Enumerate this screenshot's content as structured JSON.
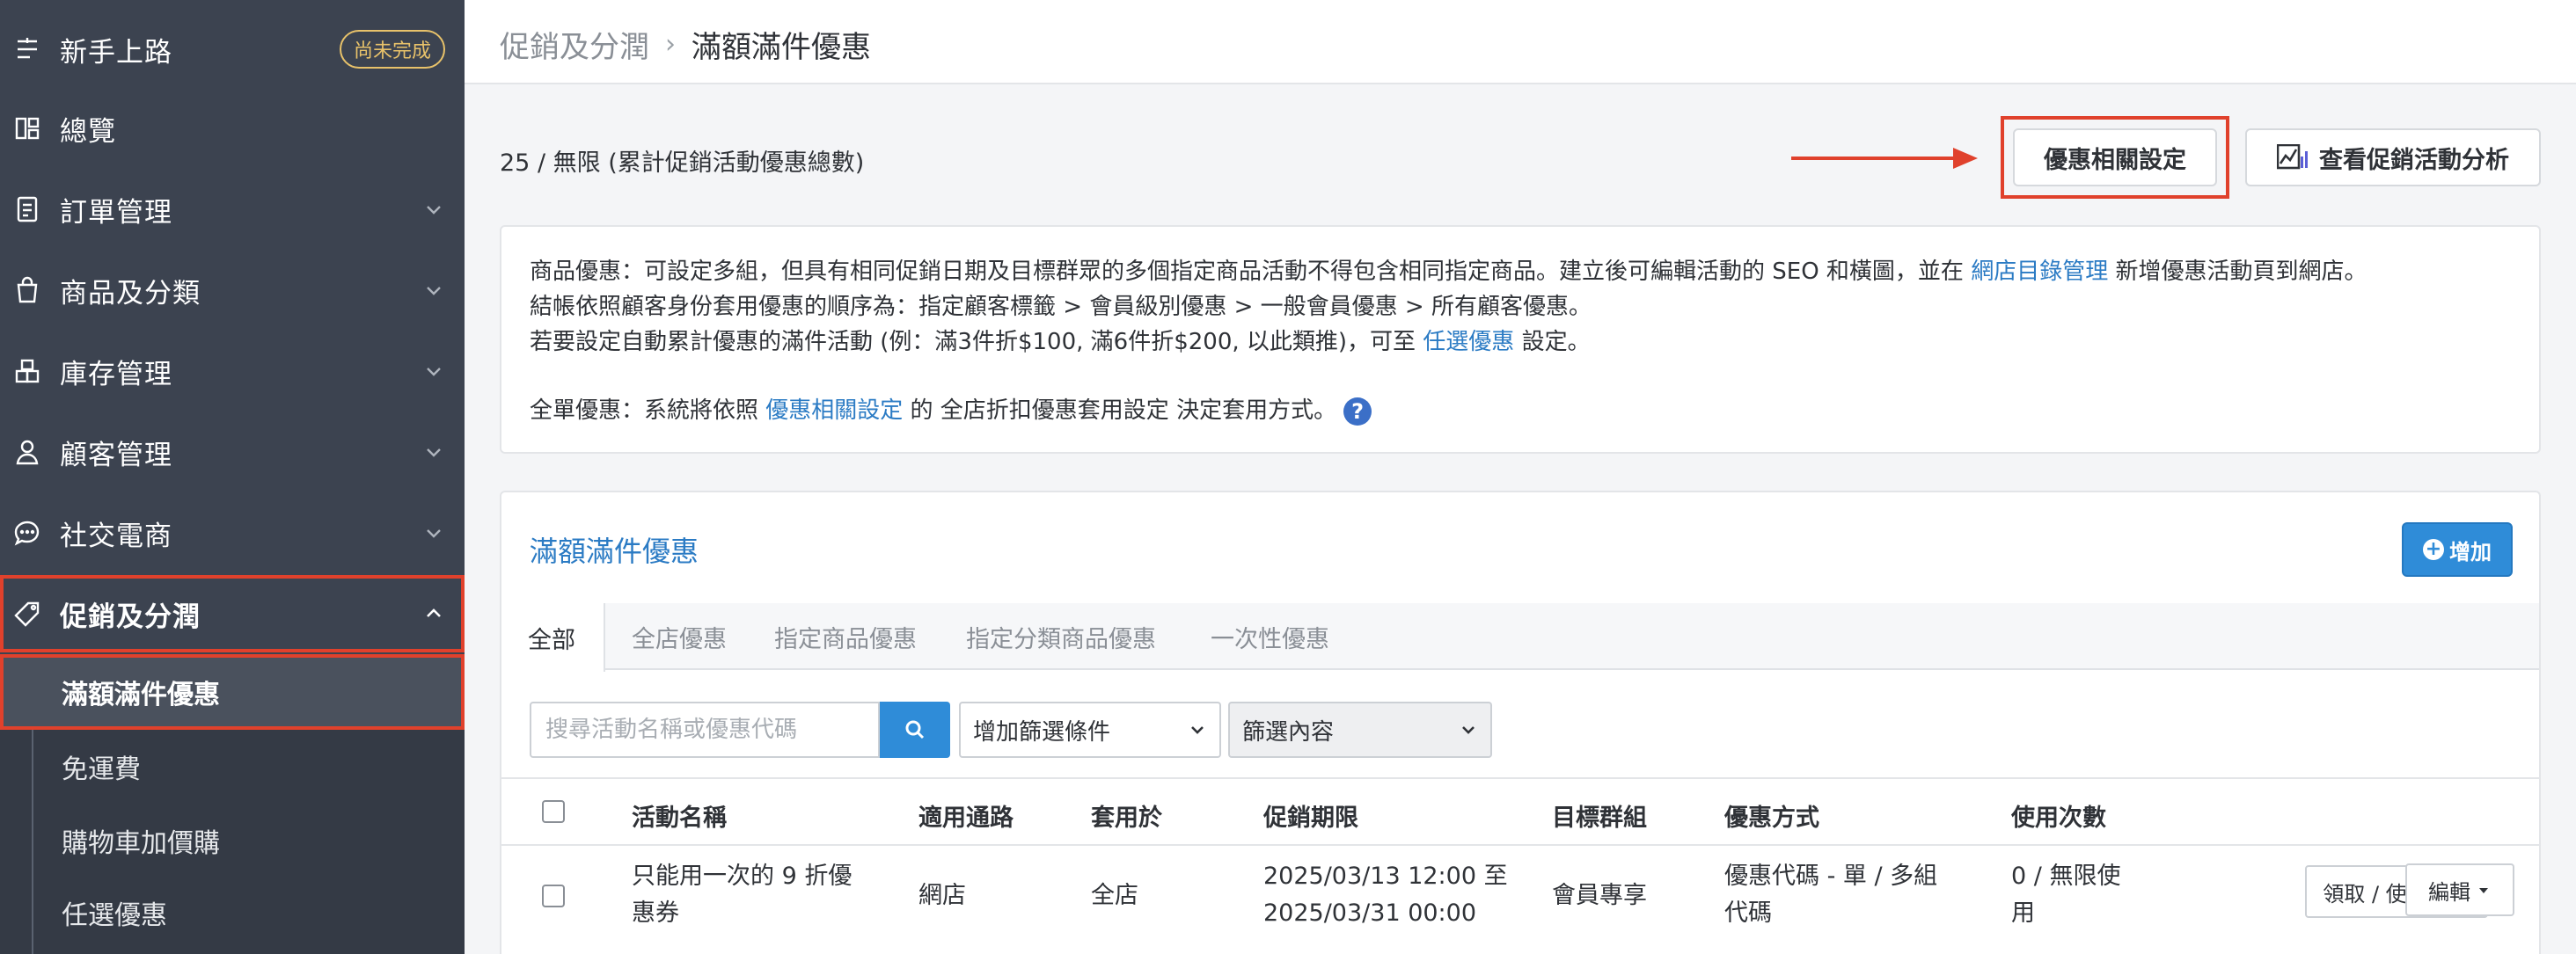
{
  "colors": {
    "sidebar_bg": "#3c4350",
    "accent_blue": "#2b7bc4",
    "highlight_red": "#e0412c",
    "badge_gold": "#e8c26a"
  },
  "sidebar": {
    "items": [
      {
        "label": "新手上路",
        "icon": "onboarding-icon",
        "badge": "尚未完成"
      },
      {
        "label": "總覽",
        "icon": "dashboard-icon"
      },
      {
        "label": "訂單管理",
        "icon": "order-icon"
      },
      {
        "label": "商品及分類",
        "icon": "shopping-bag-icon"
      },
      {
        "label": "庫存管理",
        "icon": "inventory-icon"
      },
      {
        "label": "顧客管理",
        "icon": "user-icon"
      },
      {
        "label": "社交電商",
        "icon": "chat-icon"
      },
      {
        "label": "促銷及分潤",
        "icon": "tag-icon"
      }
    ],
    "subitems": [
      {
        "label": "滿額滿件優惠"
      },
      {
        "label": "免運費"
      },
      {
        "label": "購物車加價購"
      },
      {
        "label": "任選優惠"
      }
    ]
  },
  "breadcrumb": {
    "parent": "促銷及分潤",
    "separator": "›",
    "current": "滿額滿件優惠"
  },
  "summary": {
    "count_text": "25 / 無限 (累計促銷活動優惠總數)"
  },
  "toolbar": {
    "settings_label": "優惠相關設定",
    "analytics_label": "查看促銷活動分析"
  },
  "info": {
    "line1_a": "商品優惠：可設定多組，但具有相同促銷日期及目標群眾的多個指定商品活動不得包含相同指定商品。建立後可編輯活動的 SEO 和橫圖，並在 ",
    "line1_link": "網店目錄管理",
    "line1_b": " 新增優惠活動頁到網店。",
    "line2": "結帳依照顧客身份套用優惠的順序為：指定顧客標籤 > 會員級別優惠 > 一般會員優惠 > 所有顧客優惠。",
    "line3_a": "若要設定自動累計優惠的滿件活動 (例：滿3件折$100, 滿6件折$200, 以此類推)，可至 ",
    "line3_link": "任選優惠",
    "line3_b": " 設定。",
    "line4_a": "全單優惠：系統將依照 ",
    "line4_link": "優惠相關設定",
    "line4_b": " 的 全店折扣優惠套用設定 決定套用方式。",
    "help": "?"
  },
  "panel": {
    "title": "滿額滿件優惠",
    "add_label": "增加",
    "tabs": [
      "全部",
      "全店優惠",
      "指定商品優惠",
      "指定分類商品優惠",
      "一次性優惠"
    ],
    "search": {
      "placeholder": "搜尋活動名稱或優惠代碼"
    },
    "filter_select": "增加篩選條件",
    "filter_content": "篩選內容",
    "columns": [
      "活動名稱",
      "適用通路",
      "套用於",
      "促銷期限",
      "目標群組",
      "優惠方式",
      "使用次數"
    ],
    "rows": [
      {
        "name_l1": "只能用一次的 9 折優",
        "name_l2": "惠券",
        "channel": "網店",
        "applies": "全店",
        "period_l1": "2025/03/13 12:00 至",
        "period_l2": "2025/03/31 00:00",
        "group": "會員專享",
        "method_l1": "優惠代碼 - 單 / 多組",
        "method_l2": "代碼",
        "usage_l1": "0 / 無限使",
        "usage_l2": "用",
        "log_label": "領取 / 使用紀錄",
        "edit_label": "編輯"
      }
    ]
  }
}
